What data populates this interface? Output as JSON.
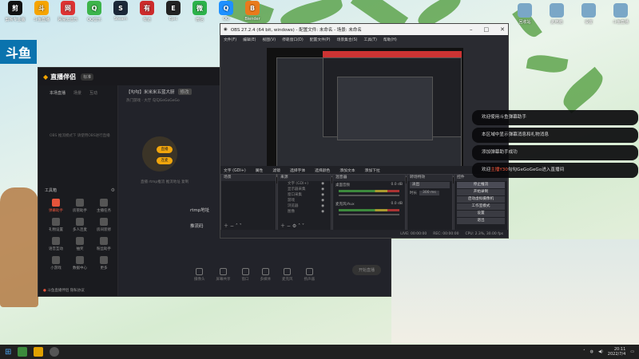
{
  "desktop_icons": [
    {
      "label": "剪映专业版",
      "color": "#111"
    },
    {
      "label": "斗鱼直播",
      "color": "#f6a400"
    },
    {
      "label": "网易云音乐",
      "color": "#d33"
    },
    {
      "label": "QQ音乐",
      "color": "#3cb44a"
    },
    {
      "label": "Steam",
      "color": "#1b2838"
    },
    {
      "label": "有道",
      "color": "#cc2b2b"
    },
    {
      "label": "Epic",
      "color": "#222"
    },
    {
      "label": "微信",
      "color": "#2cb24a"
    },
    {
      "label": "QQ",
      "color": "#1e90ff"
    },
    {
      "label": "Blender",
      "color": "#e97a1c"
    }
  ],
  "right_icons": [
    "回收站",
    "此电脑",
    "设置",
    "斗鱼直播"
  ],
  "live": {
    "logo": "直播伴侣",
    "version": "标准",
    "tabs": [
      "本场直播",
      "场景",
      "互动"
    ],
    "room_title": "【勾勾】米米米五蓝大厨",
    "edit_label": "修改",
    "sub": "热门游戏 · 大厅    勾勾GeGoGeGo",
    "hint": "OBS 推流模式下 请使用OBS进行直播",
    "flow_pills": [
      "直播",
      "连麦"
    ],
    "scene_hint": "直播 rtmp推流 推流地址 复制",
    "rtmp_label": "rtmp地址",
    "key_label": "推流码",
    "tools_title": "工具箱",
    "tools": [
      "弹幕助手",
      "房管助手",
      "主播任务",
      "礼物设置",
      "多人连麦",
      "房间装修",
      "语音互动",
      "抽奖",
      "粉丝助手",
      "小游戏",
      "数据中心",
      "更多"
    ],
    "footer_hint": "斗鱼直播伴侣 隐私协议",
    "bottom_bar": [
      "摄像头",
      "屏幕共享",
      "窗口",
      "多媒体",
      "麦克风",
      "扬声器"
    ],
    "start_btn": "开始直播"
  },
  "obs": {
    "title": "OBS 27.2.4 (64 bit, windows) - 配置文件: 未命名 - 场景: 未命名",
    "menu": [
      "文件(F)",
      "编辑(E)",
      "视图(V)",
      "停靠窗口(D)",
      "配置文件(P)",
      "场景集合(S)",
      "工具(T)",
      "帮助(H)"
    ],
    "toolbar": [
      "文字 (GDI+)",
      "属性",
      "滤镜",
      "选择字体",
      "选择颜色",
      "添加文本",
      "添加下拉"
    ],
    "scenes_title": "场景",
    "sources_title": "来源",
    "sources": [
      "文字 (GDI+)",
      "显示器采集",
      "窗口采集",
      "游戏",
      "浏览器",
      "图像"
    ],
    "mixer_title": "混音器",
    "mixer": [
      {
        "name": "桌面音频",
        "db": "0.0 dB"
      },
      {
        "name": "麦克风/Aux",
        "db": "0.0 dB"
      }
    ],
    "transition_title": "转场特效",
    "transition": "淡出",
    "duration_label": "时长",
    "duration": "300 ms",
    "controls_title": "控件",
    "controls": [
      "停止推流",
      "开始录制",
      "启动虚拟摄像机",
      "工作室模式",
      "设置",
      "退出"
    ],
    "status": [
      "LIVE: 00:00:00",
      "REC: 00:00:00",
      "CPU: 2.3%, 30.00 fps"
    ]
  },
  "chat": [
    {
      "text": "欢迎使用斗鱼弹幕助手"
    },
    {
      "text": "本区域中显示弹幕消息和礼物消息"
    },
    {
      "text": "添加弹幕助手成功"
    },
    {
      "pre": "欢迎",
      "highlight": "主播Y30",
      "post": "勾勾GeGoGeGo进入直播间"
    }
  ],
  "taskbar": {
    "clock_time": "20:11",
    "clock_date": "2022/7/4"
  }
}
